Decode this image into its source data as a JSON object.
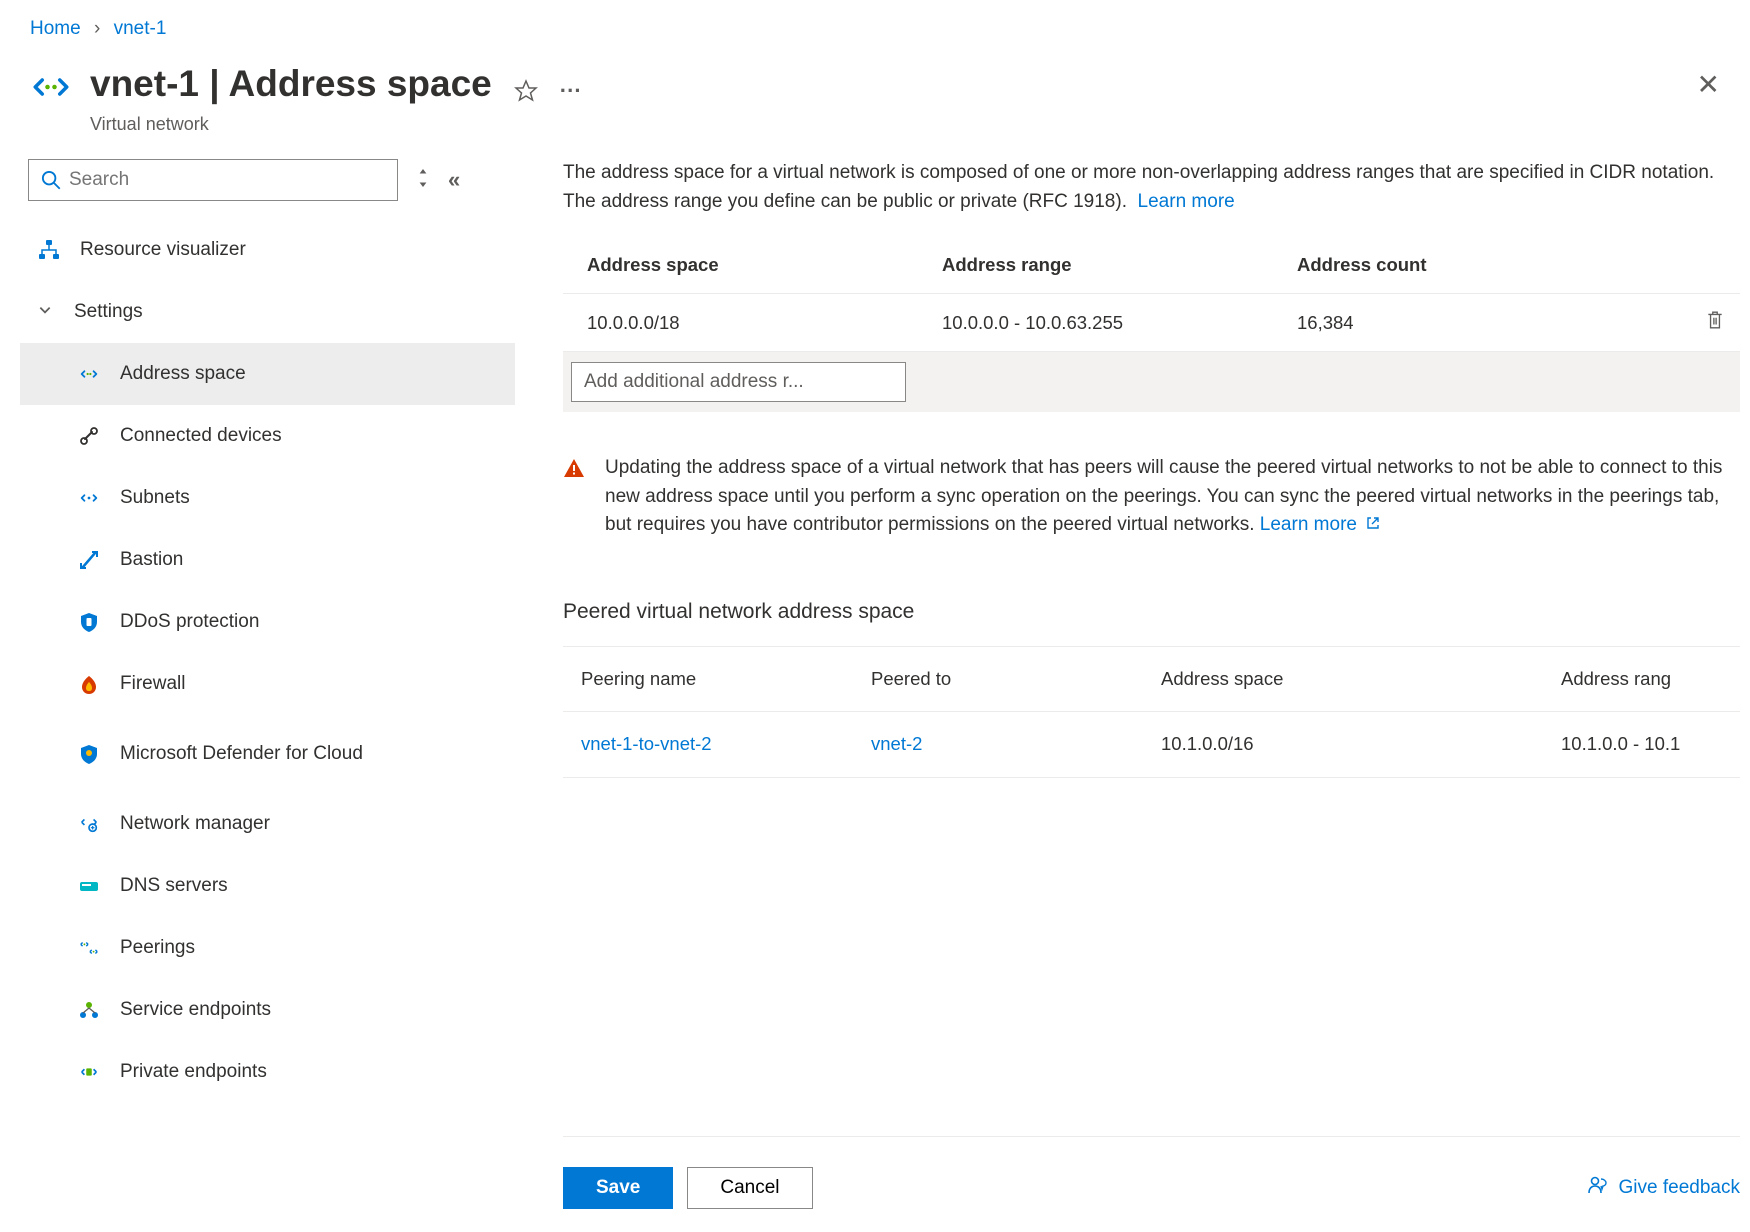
{
  "breadcrumb": {
    "home": "Home",
    "resource": "vnet-1"
  },
  "header": {
    "title": "vnet-1 | Address space",
    "subtitle": "Virtual network"
  },
  "sidebar": {
    "search_placeholder": "Search",
    "resource_visualizer": "Resource visualizer",
    "settings_label": "Settings",
    "items": {
      "address_space": "Address space",
      "connected_devices": "Connected devices",
      "subnets": "Subnets",
      "bastion": "Bastion",
      "ddos": "DDoS protection",
      "firewall": "Firewall",
      "defender": "Microsoft Defender for Cloud",
      "network_manager": "Network manager",
      "dns_servers": "DNS servers",
      "peerings": "Peerings",
      "service_endpoints": "Service endpoints",
      "private_endpoints": "Private endpoints"
    }
  },
  "main": {
    "description": "The address space for a virtual network is composed of one or more non-overlapping address ranges that are specified in CIDR notation. The address range you define can be public or private (RFC 1918).",
    "learn_more": "Learn more",
    "table": {
      "headers": {
        "space": "Address space",
        "range": "Address range",
        "count": "Address count"
      },
      "row": {
        "space": "10.0.0.0/18",
        "range": "10.0.0.0 - 10.0.63.255",
        "count": "16,384"
      },
      "add_placeholder": "Add additional address r..."
    },
    "warning": {
      "text": "Updating the address space of a virtual network that has peers will cause the peered virtual networks to not be able to connect to this new address space until you perform a sync operation on the peerings. You can sync the peered virtual networks in the peerings tab, but requires you have contributor permissions on the peered virtual networks.",
      "learn_more": "Learn more"
    },
    "peered_section_title": "Peered virtual network address space",
    "peer_table": {
      "headers": {
        "name": "Peering name",
        "to": "Peered to",
        "space": "Address space",
        "range": "Address rang"
      },
      "row": {
        "name": "vnet-1-to-vnet-2",
        "to": "vnet-2",
        "space": "10.1.0.0/16",
        "range": "10.1.0.0 - 10.1"
      }
    }
  },
  "footer": {
    "save": "Save",
    "cancel": "Cancel",
    "feedback": "Give feedback"
  }
}
